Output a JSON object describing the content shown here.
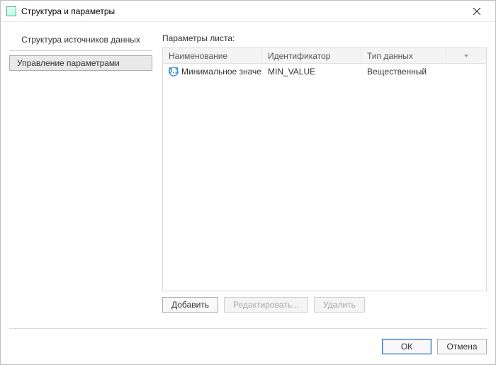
{
  "window": {
    "title": "Структура и параметры"
  },
  "left": {
    "heading": "Структура источников данных",
    "nav": {
      "manage_params": "Управление параметрами"
    }
  },
  "right": {
    "heading": "Параметры листа:",
    "columns": {
      "name": "Наименование",
      "id": "Идентификатор",
      "type": "Тип данных"
    },
    "rows": [
      {
        "name": "Минимальное значе…",
        "id": "MIN_VALUE",
        "type": "Вещественный"
      }
    ],
    "actions": {
      "add": "Добавить",
      "edit": "Редактировать...",
      "delete": "Удалить"
    }
  },
  "footer": {
    "ok": "ОК",
    "cancel": "Отмена"
  }
}
